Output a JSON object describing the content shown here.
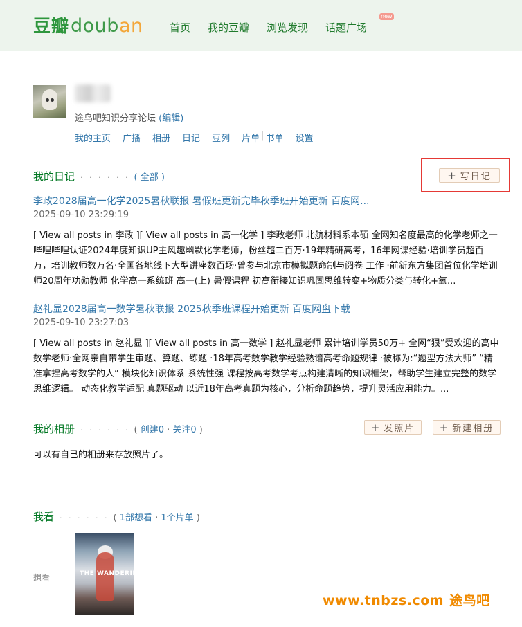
{
  "header": {
    "logo_cn": "豆瓣",
    "logo_en_left": "doub",
    "logo_en_right": "an",
    "nav": [
      "首页",
      "我的豆瓣",
      "浏览发现",
      "话题广场"
    ],
    "new_badge": "new"
  },
  "profile": {
    "signature": "途鸟吧知识分享论坛",
    "edit_label": "(编辑)",
    "nav": [
      "我的主页",
      "广播",
      "相册",
      "日记",
      "豆列",
      "片单",
      "书单",
      "设置"
    ]
  },
  "diary": {
    "title": "我的日记",
    "dots": "· · · · · ·",
    "all_label": "( 全部 )",
    "write_button": "写日记",
    "posts": [
      {
        "title": "李政2028届高一化学2025暑秋联报 暑假班更新完毕秋季班开始更新 百度网...",
        "time": "2025-09-10 23:29:19",
        "body": "[ View all posts in 李政 ][ View all posts in 高一化学 ] 李政老师 北航材料系本硕 全网知名度最高的化学老师之一 哔哩哔哩认证2024年度知识UP主风趣幽默化学老师，粉丝超二百万·19年精研高考，16年网课经验·培训学员超百万，培训教师数万名·全国各地线下大型讲座数百场·曾参与北京市模拟题命制与阅卷 工作 ·前新东方集团首位化学培训师20周年功勋教师 化学高一系统班 高一(上) 暑假课程 初高衔接知识巩固思维转变+物质分类与转化+氧..."
      },
      {
        "title": "赵礼显2028届高一数学暑秋联报 2025秋季班课程开始更新 百度网盘下载",
        "time": "2025-09-10 23:27:03",
        "body": "[ View all posts in 赵礼显 ][ View all posts in 高一数学 ] 赵礼显老师 累计培训学员50万+ 全网“狠”受欢迎的高中数学老师·全网亲自带学生审题、算题、练题 ·18年高考数学教学经验熟谙高考命题规律 ·被称为:“题型方法大师” “精准拿捏高考数学的人” 模块化知识体系 系统性强 课程按高考数学考点构建清晰的知识框架，帮助学生建立完整的数学思维逻辑。 动态化教学适配 真题驱动 以近18年高考真题为核心，分析命题趋势，提升灵活应用能力。..."
      }
    ]
  },
  "album": {
    "title": "我的相册",
    "dots": "· · · · · ·",
    "meta_open": "( ",
    "create": "创建0",
    "meta_sep": " · ",
    "follow": "关注0",
    "meta_close": " )",
    "upload_button": "发照片",
    "new_album_button": "新建相册",
    "note": "可以有自己的相册来存放照片了。"
  },
  "watching": {
    "title": "我看",
    "dots": "· · · · · ·",
    "meta_open": "( ",
    "want": "1部想看",
    "meta_sep": " · ",
    "list": "1个片单",
    "meta_close": " )",
    "row_label": "想看",
    "poster_text": "THE WANDERING EARTH"
  },
  "watermark": {
    "url": "www.tnbzs.com",
    "name": "途鸟吧"
  },
  "colors": {
    "brand_green": "#2e963d",
    "link_blue": "#37a",
    "section_green": "#072",
    "highlight_red": "#e53935",
    "watermark_orange": "#f08a00"
  }
}
